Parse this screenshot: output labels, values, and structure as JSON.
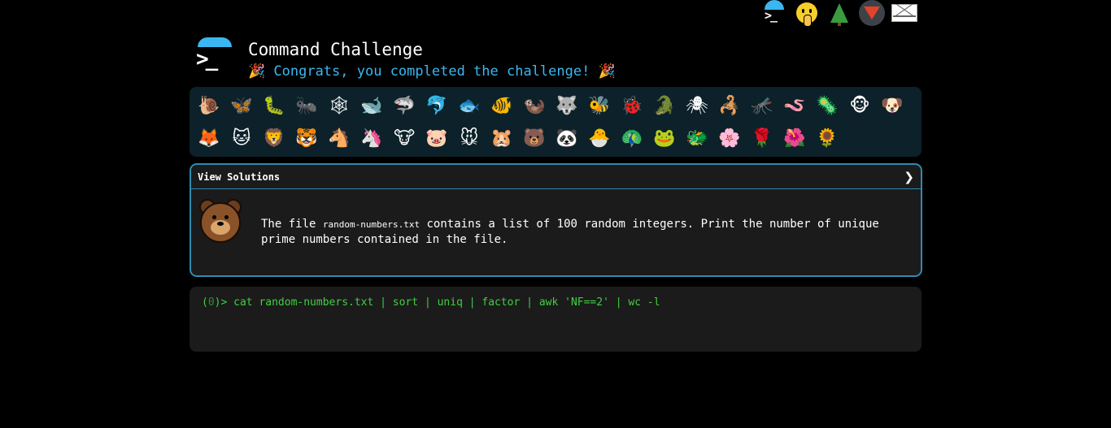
{
  "top_nav": {
    "items": [
      {
        "name": "terminal-icon"
      },
      {
        "name": "shushing-face-icon"
      },
      {
        "name": "tree-icon"
      },
      {
        "name": "gitlab-icon"
      },
      {
        "name": "mail-icon"
      }
    ]
  },
  "header": {
    "title": "Command Challenge",
    "subtitle": "🎉 Congrats, you completed the challenge! 🎉"
  },
  "animals": {
    "row1": [
      "🐌",
      "🦋",
      "🐛",
      "🐜",
      "🕸",
      "🐋",
      "🦈",
      "🐬",
      "🐟",
      "🐠",
      "🦦",
      "🐺",
      "🐝",
      "🐞",
      "🐊",
      "🕷",
      "🦂",
      "🦟",
      "🪱",
      "🦠",
      "🐵",
      "🐶"
    ],
    "row2": [
      "🦊",
      "🐱",
      "🦁",
      "🐯",
      "🐴",
      "🦄",
      "🐮",
      "🐷",
      "🐭",
      "🐹",
      "🐻",
      "🐼",
      "🐣",
      "🦚",
      "🐸",
      "🐲",
      "🌸",
      "🌹",
      "🌺",
      "🌻"
    ]
  },
  "solutions": {
    "toggle_label": "View Solutions",
    "chevron": "❯",
    "text_before": "The file ",
    "filename": "random-numbers.txt",
    "text_after": " contains a list of 100 random integers. Print the number of unique prime numbers contained in the file."
  },
  "terminal": {
    "prompt_open": "(",
    "prompt_num": "0",
    "prompt_close": ")> ",
    "command": "cat random-numbers.txt | sort | uniq | factor | awk 'NF==2' | wc -l"
  },
  "colors": {
    "accent": "#3ab7f0",
    "terminal_green": "#3fd13f",
    "panel_border": "#2e8bb0"
  }
}
